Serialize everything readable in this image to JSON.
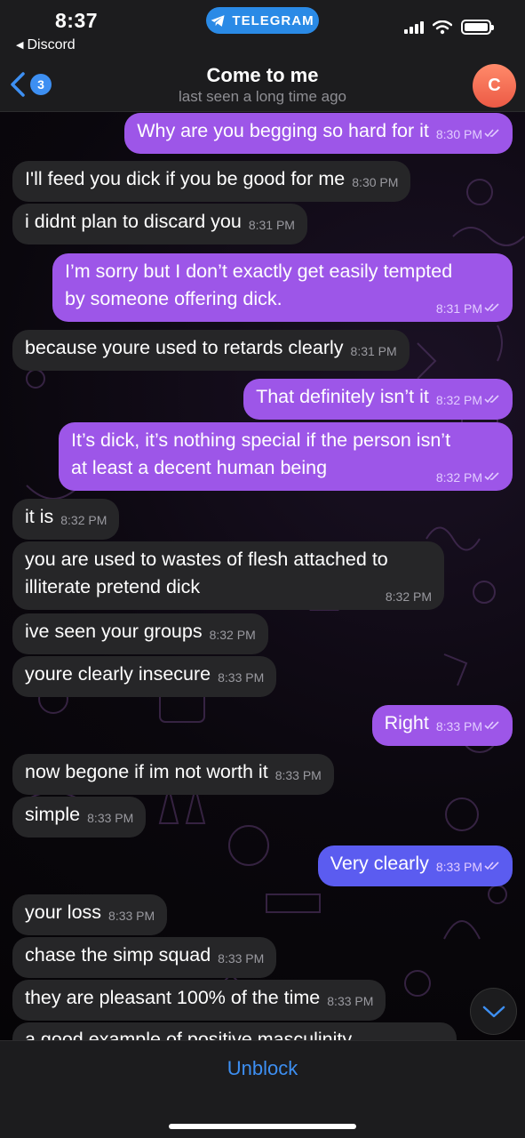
{
  "status_bar": {
    "time": "8:37",
    "back_app": "Discord",
    "app_pill": "TELEGRAM"
  },
  "header": {
    "back_count": "3",
    "title": "Come to me",
    "subtitle": "last seen a long time ago",
    "avatar_letter": "C"
  },
  "messages": [
    {
      "dir": "out",
      "text": "Why are you begging so hard for it",
      "time": "8:30 PM"
    },
    {
      "dir": "in",
      "text": "I'll feed you dick if you be good for me",
      "time": "8:30 PM"
    },
    {
      "dir": "in",
      "text": "i didnt plan to discard you",
      "time": "8:31 PM"
    },
    {
      "dir": "out",
      "text_lines": [
        "I’m sorry but I don’t exactly get easily tempted",
        "by someone offering dick."
      ],
      "time": "8:31 PM"
    },
    {
      "dir": "in",
      "text": "because youre used to retards clearly",
      "time": "8:31 PM"
    },
    {
      "dir": "out",
      "text": "That definitely isn’t it",
      "time": "8:32 PM"
    },
    {
      "dir": "out",
      "text_lines": [
        "It’s dick, it’s nothing special if the person isn’t",
        "at least a decent human being"
      ],
      "time": "8:32 PM"
    },
    {
      "dir": "in",
      "text": "it is",
      "time": "8:32 PM"
    },
    {
      "dir": "in",
      "text_lines": [
        "you are used to wastes of flesh attached to",
        "illiterate pretend dick"
      ],
      "time": "8:32 PM"
    },
    {
      "dir": "in",
      "text": "ive seen your groups",
      "time": "8:32 PM"
    },
    {
      "dir": "in",
      "text": "youre clearly insecure",
      "time": "8:33 PM"
    },
    {
      "dir": "out",
      "text": "Right",
      "time": "8:33 PM"
    },
    {
      "dir": "in",
      "text": "now begone if im not worth it",
      "time": "8:33 PM"
    },
    {
      "dir": "in",
      "text": "simple",
      "time": "8:33 PM"
    },
    {
      "dir": "out",
      "text": "Very clearly",
      "time": "8:33 PM"
    },
    {
      "dir": "in",
      "text": "your loss",
      "time": "8:33 PM"
    },
    {
      "dir": "in",
      "text": "chase the simp squad",
      "time": "8:33 PM"
    },
    {
      "dir": "in",
      "text": "they are pleasant 100% of the time",
      "time": "8:33 PM"
    },
    {
      "dir": "in",
      "text": "a good example of positive masculinity"
    }
  ],
  "bottom": {
    "action_label": "Unblock"
  },
  "colors": {
    "outgoing_bubble": "#9d56e8",
    "outgoing_bubble_last": "#5b5cf0",
    "incoming_bubble": "#262628",
    "accent": "#3d8ff2",
    "avatar": "#ec5a45"
  },
  "icons": [
    "back-chevron-icon",
    "telegram-plane-icon",
    "signal-icon",
    "wifi-icon",
    "battery-icon",
    "double-check-icon",
    "chevron-down-icon"
  ]
}
